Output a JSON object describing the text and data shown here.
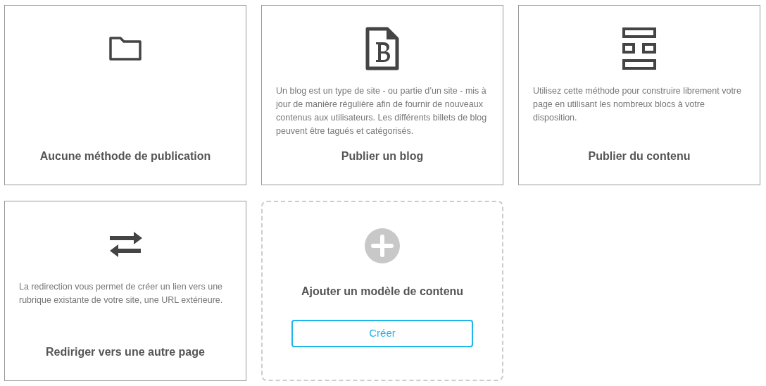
{
  "cards": [
    {
      "kind": "method",
      "title": "Aucune méthode de publication"
    },
    {
      "kind": "method",
      "title": "Publier un blog",
      "description": "Un blog est un type de site - ou partie d’un site - mis à jour de manière régulière afin de fournir de nouveaux contenus aux utilisateurs. Les différents billets de blog peuvent être tagués et catégorisés."
    },
    {
      "kind": "method",
      "title": "Publier du contenu",
      "description": "Utilisez cette méthode pour construire librement votre page en utilisant les nombreux blocs à votre disposition."
    },
    {
      "kind": "method",
      "title": "Rediriger vers une autre page",
      "description": "La redirection vous permet de créer un lien vers une rubrique existante de votre site, une URL extérieure."
    },
    {
      "kind": "add",
      "title": "Ajouter un modèle de contenu",
      "button": "Créer"
    }
  ]
}
